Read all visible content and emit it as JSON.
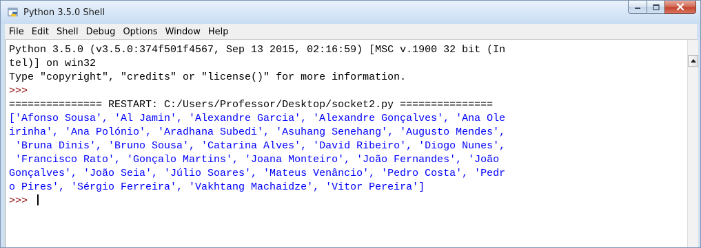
{
  "window": {
    "title": "Python 3.5.0 Shell",
    "app_icon": "python-shell-icon",
    "caption_buttons": [
      "minimize-icon",
      "maximize-icon",
      "close-icon"
    ]
  },
  "menu": [
    "File",
    "Edit",
    "Shell",
    "Debug",
    "Options",
    "Window",
    "Help"
  ],
  "shell": {
    "lines": [
      "Python 3.5.0 (v3.5.0:374f501f4567, Sep 13 2015, 02:16:59) [MSC v.1900 32 bit (In",
      "tel)] on win32",
      "Type \"copyright\", \"credits\" or \"license()\" for more information.",
      ">>> ",
      "=============== RESTART: C:/Users/Professor/Desktop/socket2.py ===============",
      "['Afonso Sousa', 'Al Jamin', 'Alexandre Garcia', 'Alexandre Gonçalves', 'Ana Ole",
      "irinha', 'Ana Polónio', 'Aradhana Subedi', 'Asuhang Senehang', 'Augusto Mendes',",
      " 'Bruna Dinis', 'Bruno Sousa', 'Catarina Alves', 'David Ribeiro', 'Diogo Nunes',",
      " 'Francisco Rato', 'Gonçalo Martins', 'Joana Monteiro', 'João Fernandes', 'João",
      "Gonçalves', 'João Seia', 'Júlio Soares', 'Mateus Venâncio', 'Pedro Costa', 'Pedr",
      "o Pires', 'Sérgio Ferreira', 'Vakhtang Machaidze', 'Vitor Pereira']",
      ">>> "
    ]
  },
  "colors": {
    "prompt": "#8b0000",
    "output": "#0000ff",
    "text": "#000000",
    "close_button": "#c4452e"
  }
}
